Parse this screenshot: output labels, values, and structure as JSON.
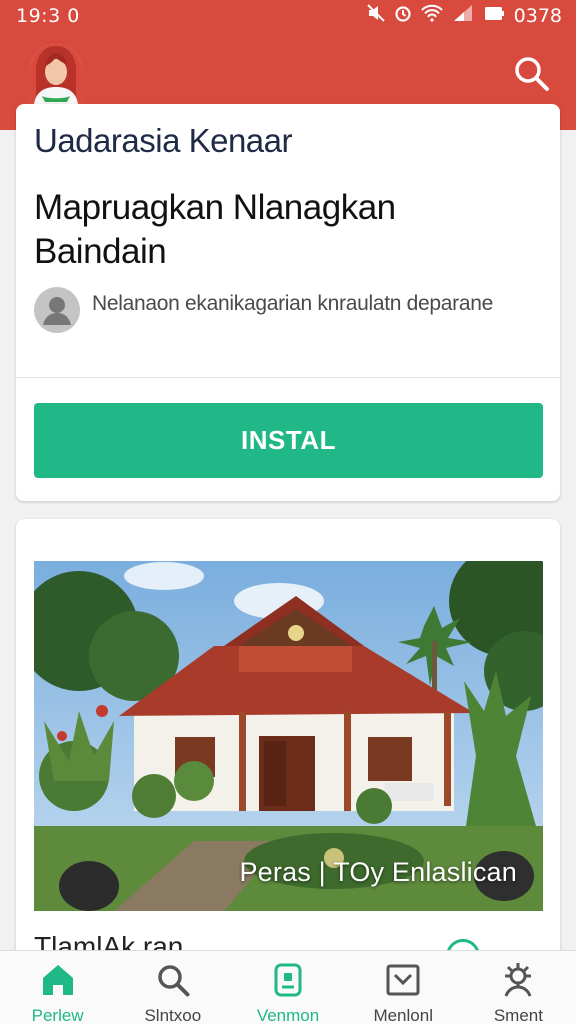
{
  "status_bar": {
    "time": "19:3 0",
    "battery_text": "0378"
  },
  "app": {
    "name": "Uadarasia  Kenaar",
    "headline": "Mapruagkan Nlanagkan Baindain",
    "developer_line": "Nelanaon ekanikagarian knraulatn deparane",
    "install_label": "INSTAL"
  },
  "media": {
    "photo_caption": "Peras | TOy Enlaslican",
    "section_title_partial": "TlamlAk ran"
  },
  "bottom_nav": {
    "items": [
      {
        "label": "Perlew",
        "icon": "home-icon",
        "active": true
      },
      {
        "label": "Slntxoo",
        "icon": "search-icon",
        "active": false
      },
      {
        "label": "Venmon",
        "icon": "device-icon",
        "active": false
      },
      {
        "label": "Menlonl",
        "icon": "inbox-icon",
        "active": false
      },
      {
        "label": "Sment",
        "icon": "settings-icon",
        "active": false
      }
    ]
  },
  "colors": {
    "appbar": "#d94a3e",
    "accent": "#1fb886",
    "background": "#f1f1f1"
  }
}
